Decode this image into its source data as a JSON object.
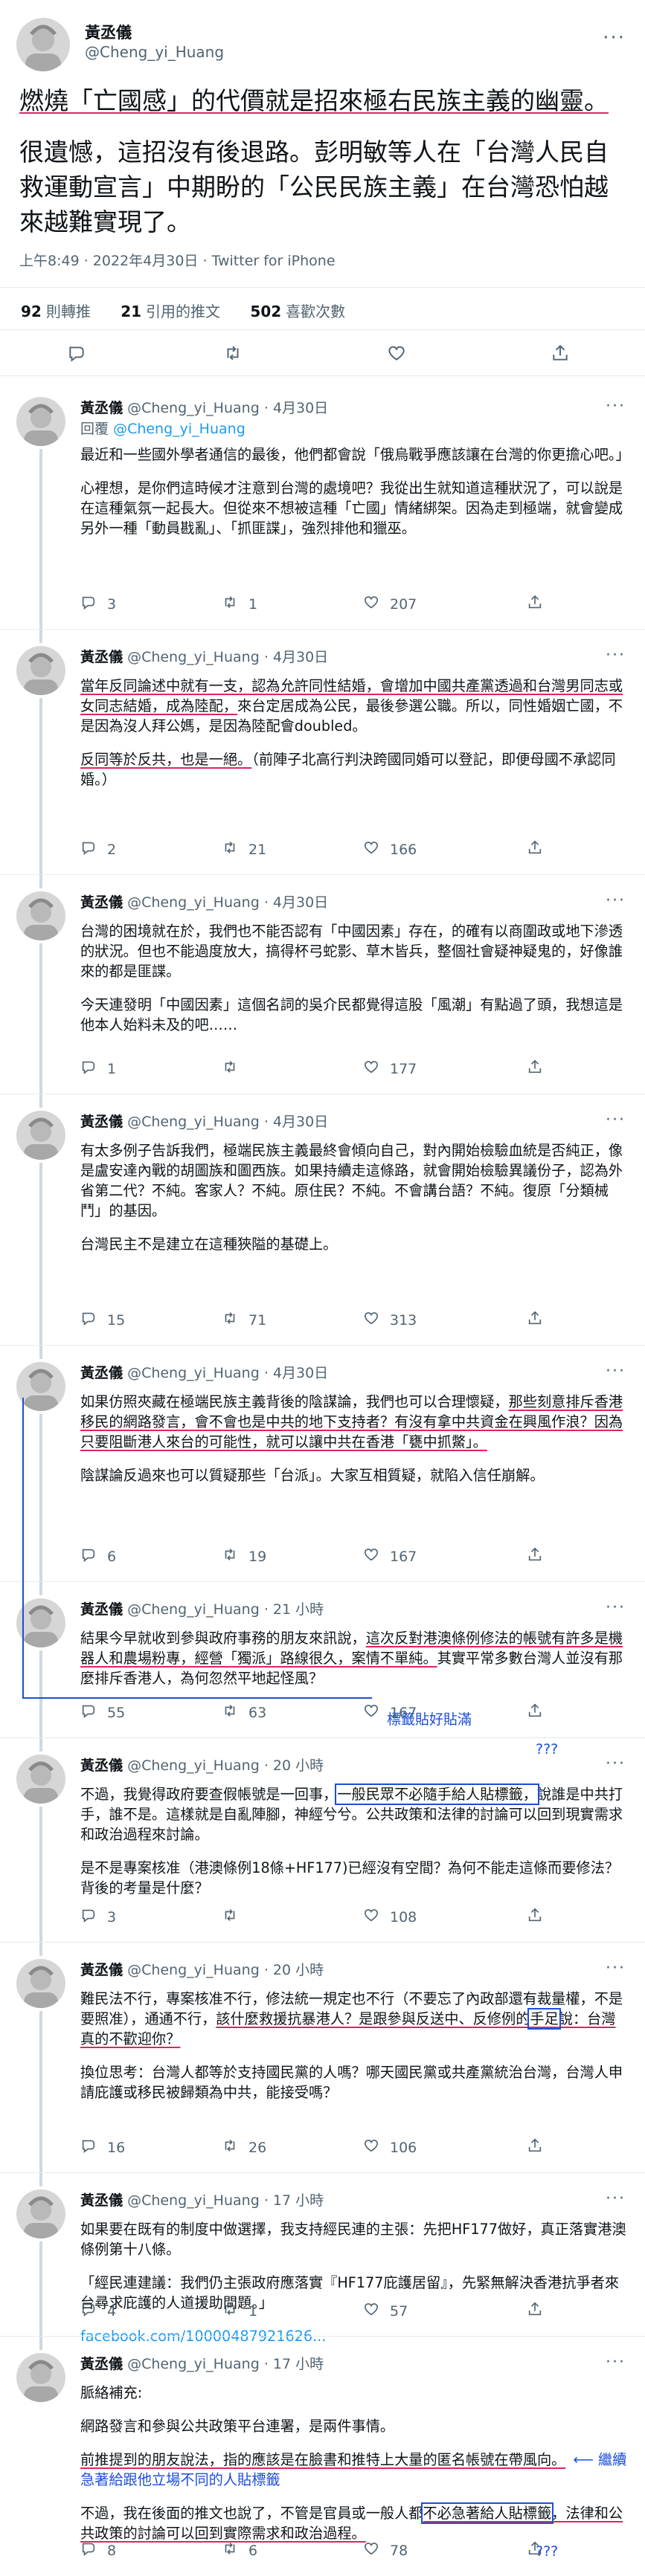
{
  "main": {
    "name": "黃丞儀",
    "handle": "@Cheng_yi_Huang",
    "para1": "燃燒「亡國感」的代價就是招來極右民族主義的幽靈。",
    "para2": "很遺憾，這招沒有後退路。彭明敏等人在「台灣人民自救運動宣言」中期盼的「公民民族主義」在台灣恐怕越來越難實現了。",
    "meta": "上午8:49 · 2022年4月30日 · Twitter for iPhone",
    "retweets_count": "92",
    "retweets_label": "則轉推",
    "quotes_count": "21",
    "quotes_label": "引用的推文",
    "likes_count": "502",
    "likes_label": "喜歡次數"
  },
  "replies": [
    {
      "name": "黃丞儀",
      "handle": "@Cheng_yi_Huang",
      "time": "· 4月30日",
      "replying_prefix": "回覆",
      "replying_to": "@Cheng_yi_Huang",
      "p1": "最近和一些國外學者通信的最後，他們都會說「俄烏戰爭應該讓在台灣的你更擔心吧。」",
      "p2": "心裡想，是你們這時候才注意到台灣的處境吧？我從出生就知道這種狀況了，可以說是在這種氣氛一起長大。但從來不想被這種「亡國」情緒綁架。因為走到極端，就會變成另外一種「動員戡亂」、「抓匪諜」，強烈排他和獵巫。",
      "reply_count": "3",
      "retweet_count": "1",
      "like_count": "207"
    },
    {
      "name": "黃丞儀",
      "handle": "@Cheng_yi_Huang",
      "time": "· 4月30日",
      "p1a": "當年反同論述中就有一支，認為允許同性結婚，會增加中國共產黨透過和台灣男同志或女同志結婚，成為陸配，",
      "p1b": "來台定居成為公民，最後參選公職。所以，同性婚姻亡國，不是因為沒人拜公媽，是因為陸配會doubled。",
      "p2a": "反同等於反共，也是一絕。",
      "p2b": "（前陣子北高行判決跨國同婚可以登記，即便母國不承認同婚。）",
      "reply_count": "2",
      "retweet_count": "21",
      "like_count": "166"
    },
    {
      "name": "黃丞儀",
      "handle": "@Cheng_yi_Huang",
      "time": "· 4月30日",
      "p1": "台灣的困境就在於，我們也不能否認有「中國因素」存在，的確有以商圍政或地下滲透的狀況。但也不能過度放大，搞得杯弓蛇影、草木皆兵，整個社會疑神疑鬼的，好像誰來的都是匪諜。",
      "p2": "今天連發明「中國因素」這個名詞的吳介民都覺得這股「風潮」有點過了頭，我想這是他本人始料未及的吧……",
      "reply_count": "1",
      "retweet_count": "",
      "like_count": "177"
    },
    {
      "name": "黃丞儀",
      "handle": "@Cheng_yi_Huang",
      "time": "· 4月30日",
      "p1": "有太多例子告訴我們，極端民族主義最終會傾向自己，對內開始檢驗血統是否純正，像是盧安達內戰的胡圖族和圖西族。如果持續走這條路，就會開始檢驗異議份子，認為外省第二代？不純。客家人？不純。原住民？不純。不會講台語？不純。復原「分類械鬥」的基因。",
      "p2": "台灣民主不是建立在這種狹隘的基礎上。",
      "reply_count": "15",
      "retweet_count": "71",
      "like_count": "313"
    },
    {
      "name": "黃丞儀",
      "handle": "@Cheng_yi_Huang",
      "time": "· 4月30日",
      "p1a": "如果仿照夾藏在極端民族主義背後的陰謀論，我們也可以合理懷疑，",
      "p1b": "那些刻意排斥香港移民的網路發言，會不會也是中共的地下支持者？有沒有拿中共資金在興風作浪？因為只要阻斷港人來台的可能性，就可以讓中共在香港「甕中抓鱉」。",
      "p2": "陰謀論反過來也可以質疑那些「台派」。大家互相質疑，就陷入信任崩解。",
      "reply_count": "6",
      "retweet_count": "19",
      "like_count": "167"
    },
    {
      "name": "黃丞儀",
      "handle": "@Cheng_yi_Huang",
      "time": "· 21 小時",
      "p1a": "結果今早就收到參與政府事務的朋友來訊說，",
      "p1b": "這次反對港澳條例修法的帳號有許多是機器人和農場粉專，經營「獨派」路線很久，案情不單純。",
      "p1c": "其實平常多數台灣人並沒有那麼排斥香港人，為何忽然平地起怪風？",
      "reply_count": "55",
      "retweet_count": "63",
      "like_count": "167",
      "annotation": "標籤貼好貼滿"
    },
    {
      "name": "黃丞儀",
      "handle": "@Cheng_yi_Huang",
      "time": "· 20 小時",
      "p1a": "不過，我覺得政府要查假帳號是一回事，",
      "p1b": "一般民眾不必隨手給人貼標籤，",
      "p1c": "說誰是中共打手，誰不是。這樣就是自亂陣腳，神經兮兮。公共政策和法律的討論可以回到現實需求和政治過程來討論。",
      "p2": "是不是專案核准（港澳條例18條+HF177)已經沒有空間？為何不能走這條而要修法？背後的考量是什麼？",
      "reply_count": "3",
      "retweet_count": "",
      "like_count": "108",
      "annotation": "???"
    },
    {
      "name": "黃丞儀",
      "handle": "@Cheng_yi_Huang",
      "time": "· 20 小時",
      "p1a": "難民法不行，專案核准不行，修法統一規定也不行（不要忘了內政部還有裁量權，不是要照准），通通不行，",
      "p1b": "該什麼救援抗暴港人？是跟參與反送中、反修例的",
      "p1c": "手足",
      "p1d": "說：台灣真的不歡迎你？",
      "p2": "換位思考：台灣人都等於支持國民黨的人嗎？哪天國民黨或共產黨統治台灣，台灣人申請庇護或移民被歸類為中共，能接受嗎？",
      "reply_count": "16",
      "retweet_count": "26",
      "like_count": "106"
    },
    {
      "name": "黃丞儀",
      "handle": "@Cheng_yi_Huang",
      "time": "· 17 小時",
      "p1": "如果要在既有的制度中做選擇，我支持經民連的主張：先把HF177做好，真正落實港澳條例第十八條。",
      "p2": "「經民連建議：我們仍主張政府應落實『HF177庇護居留』，先緊無解決香港抗爭者來台尋求庇護的人道援助問題。」",
      "link": "facebook.com/10000487921626...",
      "reply_count": "4",
      "retweet_count": "1",
      "like_count": "57"
    },
    {
      "name": "黃丞儀",
      "handle": "@Cheng_yi_Huang",
      "time": "· 17 小時",
      "p1": "脈絡補充:",
      "p2": "網路發言和參與公共政策平台連署，是兩件事情。",
      "p3a": "前推提到的朋友說法，指的應該是在臉書和推特上大量的匿名帳號在帶風向。",
      "p3b": "繼續急著給跟他立場不同的人貼標籤",
      "p4a": "不過，我在後面的推文也說了，不管是官員或一般人都",
      "p4b": "不必急著給人貼標籤",
      "p4c": "，法律和公共政策的討論可以回到實際需求和政治過程。",
      "reply_count": "8",
      "retweet_count": "6",
      "like_count": "78",
      "annotation": "???"
    }
  ],
  "colors": {
    "text": "#0f1419",
    "secondary": "#536471",
    "link": "#1d9bf0",
    "annotation_red": "#e0245e",
    "annotation_blue": "#1d4ed8"
  },
  "icons": [
    "more-icon",
    "reply-icon",
    "retweet-icon",
    "like-icon",
    "share-icon"
  ]
}
